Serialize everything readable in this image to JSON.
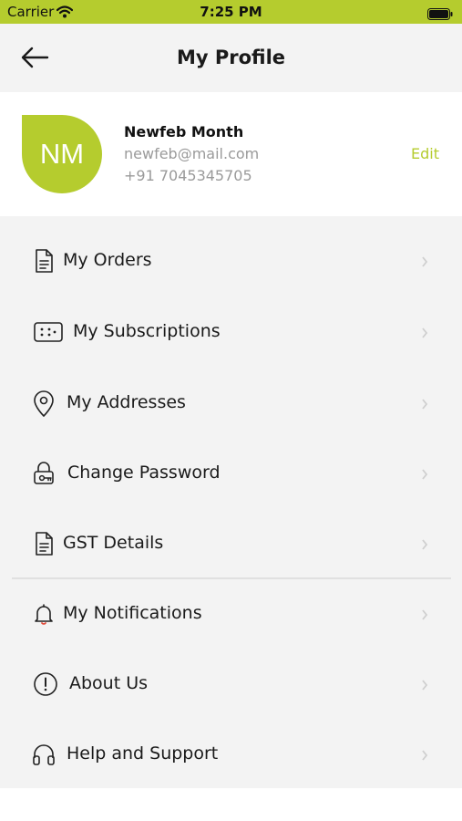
{
  "status_bar": {
    "carrier": "Carrier",
    "time": "7:25 PM"
  },
  "nav": {
    "title": "My Profile"
  },
  "profile": {
    "initials": "NM",
    "name": "Newfeb Month",
    "email": "newfeb@mail.com",
    "phone": "+91 7045345705",
    "edit_label": "Edit"
  },
  "menu": {
    "items": [
      {
        "label": "My Orders",
        "icon": "document-icon"
      },
      {
        "label": "My Subscriptions",
        "icon": "subscription-card-icon"
      },
      {
        "label": "My Addresses",
        "icon": "location-pin-icon"
      },
      {
        "label": "Change Password",
        "icon": "lock-key-icon"
      },
      {
        "label": "GST Details",
        "icon": "document-icon"
      },
      {
        "label": "My Notifications",
        "icon": "bell-icon"
      },
      {
        "label": "About Us",
        "icon": "info-icon"
      },
      {
        "label": "Help and Support",
        "icon": "headphones-icon"
      }
    ]
  },
  "colors": {
    "accent": "#b5cc2e",
    "background": "#f3f3f3",
    "muted_text": "#9a9a9a"
  }
}
